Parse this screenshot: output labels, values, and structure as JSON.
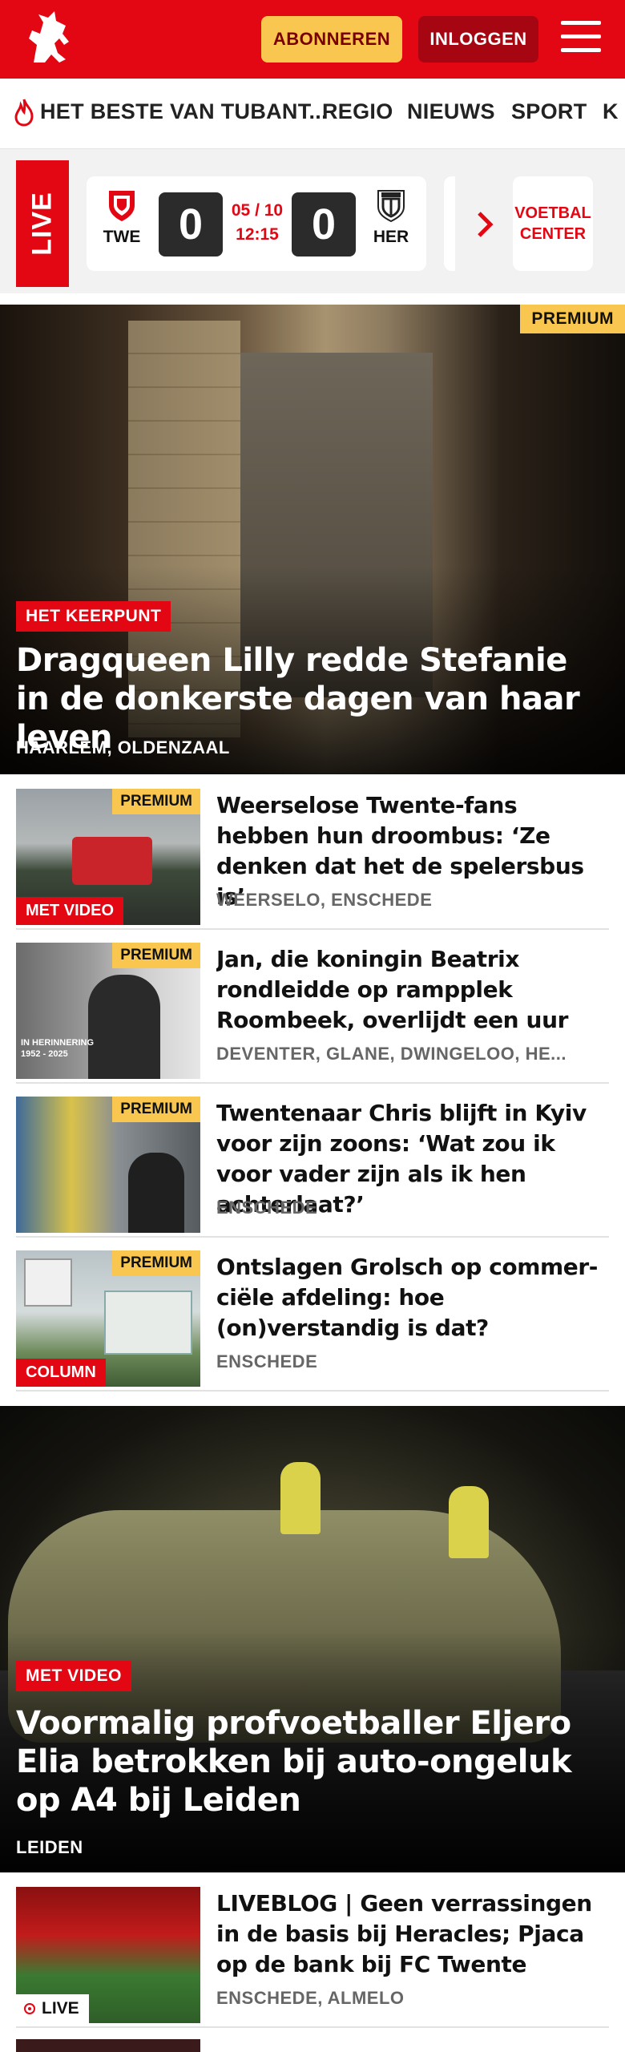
{
  "header": {
    "subscribe_label": "ABONNEREN",
    "login_label": "INLOGGEN",
    "brand_color": "#e30613",
    "logo_icon": "horse-icon",
    "menu_icon": "hamburger-menu-icon"
  },
  "nav": {
    "items": [
      {
        "label": "HET BESTE VAN TUBANT...",
        "icon": "flame-icon"
      },
      {
        "label": "REGIO"
      },
      {
        "label": "NIEUWS"
      },
      {
        "label": "SPORT"
      },
      {
        "label": "K"
      }
    ]
  },
  "live": {
    "tag": "LIVE",
    "home_code": "TWE",
    "home_score": "0",
    "away_code": "HER",
    "away_score": "0",
    "date": "05 / 10",
    "time": "12:15",
    "center_line1": "VOETBAL",
    "center_line2": "CENTER"
  },
  "hero1": {
    "badge": "PREMIUM",
    "label": "HET KEERPUNT",
    "title": "Dragqueen Lilly redde Stefanie in de donkerste dagen van haar leven",
    "location": "HAARLEM, OLDENZAAL"
  },
  "articles": [
    {
      "title": "Weerselose Twente-fans hebben hun droombus: ‘Ze denken dat het de spelersbus is’",
      "location": "WEERSELO, ENSCHEDE",
      "badge": "PREMIUM",
      "label": "MET VIDEO"
    },
    {
      "title": "Jan, die koningin Beatrix rondleidde op rampplek Roombeek, overlijdt een uur vo...",
      "location": "DEVENTER, GLANE, DWINGELOO, HE...",
      "badge": "PREMIUM",
      "thumb_caption_1": "IN HERINNERING",
      "thumb_caption_2": "1952 - 2025"
    },
    {
      "title": "Twentenaar Chris blijft in Kyiv voor zijn zoons: ‘Wat zou ik voor vader zijn als ik hen achterlaat?’",
      "location": "ENSCHEDE",
      "badge": "PREMIUM"
    },
    {
      "title": "Ontslagen Grolsch op commer-ciële afdeling: hoe (on)verstandig is dat?",
      "location": "ENSCHEDE",
      "badge": "PREMIUM",
      "label": "COLUMN"
    }
  ],
  "hero2": {
    "label": "MET VIDEO",
    "title": "Voormalig profvoetballer Eljero Elia betrokken bij auto-ongeluk op A4 bij Leiden",
    "location": "LEIDEN"
  },
  "liveblog": {
    "title": "LIVEBLOG | Geen verrassingen in de basis bij Heracles; Pjaca op de bank bij FC Twente",
    "location": "ENSCHEDE, ALMELO",
    "chip": "LIVE"
  }
}
